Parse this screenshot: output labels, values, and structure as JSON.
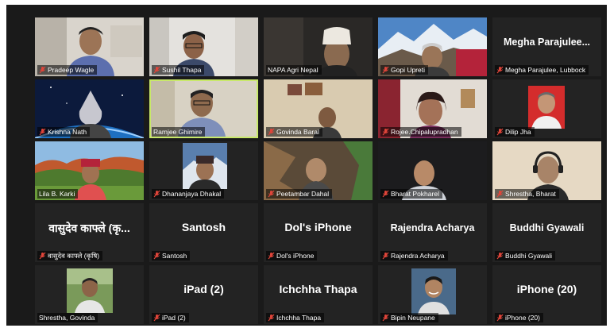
{
  "colors": {
    "grid_bg": "#1a1a1a",
    "tile_bg": "#232323",
    "active_border": "#c8e86a",
    "mic_muted": "#e0453a"
  },
  "participants": [
    {
      "name": "Pradeep Wagle",
      "video": true
    },
    {
      "name": "Sushil Thapa",
      "video": true
    },
    {
      "name": "NAPA Agri Nepal",
      "video": true
    },
    {
      "name": "Gopi Upreti",
      "video": true
    },
    {
      "name": "Megha Parajulee, Lubbock",
      "display": "Megha  Parajulee...",
      "video": false
    },
    {
      "name": "Krishna Nath",
      "video": true
    },
    {
      "name": "Ramjee Ghimire",
      "video": true,
      "speaking": true
    },
    {
      "name": "Govinda Baral",
      "video": true
    },
    {
      "name": "Rojee.Chipalupradhan",
      "video": true
    },
    {
      "name": "Dilip Jha",
      "video": true
    },
    {
      "name": "Lila B. Karki",
      "video": true
    },
    {
      "name": "Dhananjaya Dhakal",
      "video": true
    },
    {
      "name": "Peetambar Dahal",
      "video": true
    },
    {
      "name": "Bharat Pokharel",
      "video": true
    },
    {
      "name": "Shrestha, Bharat",
      "video": true
    },
    {
      "name": "वासुदेव काफ्ले (कृषि)",
      "display": "वासुदेव काफ्ले (कृ...",
      "video": false
    },
    {
      "name": "Santosh",
      "display": "Santosh",
      "video": false
    },
    {
      "name": "Dol's iPhone",
      "display": "Dol's iPhone",
      "video": false
    },
    {
      "name": "Rajendra Acharya",
      "display": "Rajendra Acharya",
      "video": false
    },
    {
      "name": "Buddhi Gyawali",
      "display": "Buddhi Gyawali",
      "video": false
    },
    {
      "name": "Shrestha, Govinda",
      "video": true
    },
    {
      "name": "iPad (2)",
      "display": "iPad (2)",
      "video": false
    },
    {
      "name": "Ichchha Thapa",
      "display": "Ichchha Thapa",
      "video": false
    },
    {
      "name": "Bipin Neupane",
      "video": true
    },
    {
      "name": "iPhone (20)",
      "display": "iPhone (20)",
      "video": false
    }
  ]
}
